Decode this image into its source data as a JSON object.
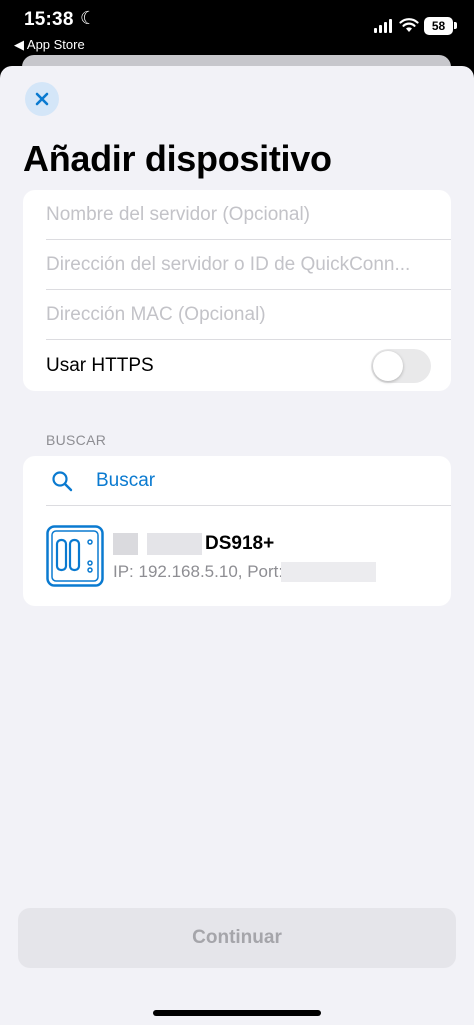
{
  "status_bar": {
    "time": "15:38",
    "back_app": "◀ App Store",
    "battery": "58"
  },
  "sheet": {
    "title": "Añadir dispositivo",
    "form": {
      "server_name_placeholder": "Nombre del servidor (Opcional)",
      "server_address_placeholder": "Dirección del servidor o ID de QuickConn...",
      "mac_placeholder": "Dirección MAC (Opcional)",
      "https_label": "Usar HTTPS",
      "https_enabled": false
    },
    "search_section": {
      "header": "BUSCAR",
      "search_label": "Buscar",
      "devices": [
        {
          "name": "DS918+",
          "ip_text": "IP: 192.168.5.10, Port:"
        }
      ]
    },
    "continue_label": "Continuar"
  },
  "colors": {
    "accent": "#0a7ad0",
    "background": "#f2f2f7",
    "placeholder": "#c3c3c8"
  },
  "icons": [
    "close-icon",
    "moon-icon",
    "signal-icon",
    "wifi-icon",
    "battery-icon",
    "search-icon",
    "nas-device-icon"
  ]
}
